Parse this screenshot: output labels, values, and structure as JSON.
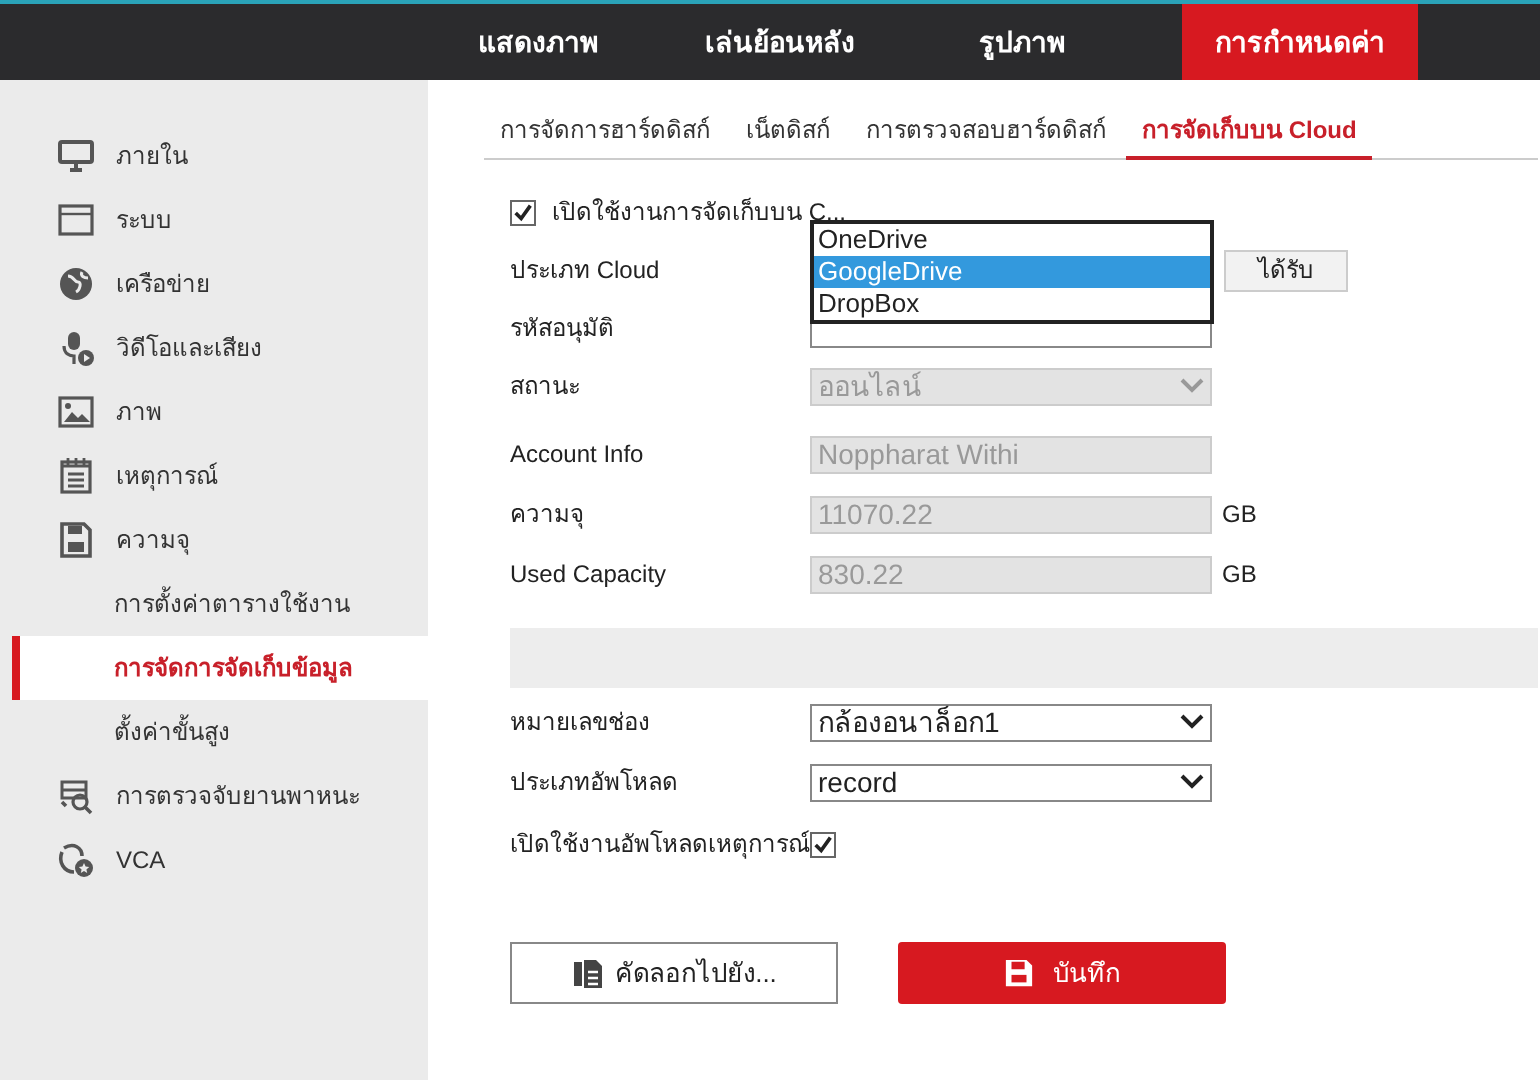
{
  "top_nav": [
    {
      "label": "แสดงภาพ",
      "selected": false
    },
    {
      "label": "เล่นย้อนหลัง",
      "selected": false
    },
    {
      "label": "รูปภาพ",
      "selected": false
    },
    {
      "label": "การกำหนดค่า",
      "selected": true
    }
  ],
  "sidebar": {
    "items": [
      {
        "label": "ภายใน",
        "kind": "monitor",
        "selected": false
      },
      {
        "label": "ระบบ",
        "kind": "window",
        "selected": false
      },
      {
        "label": "เครือข่าย",
        "kind": "globe",
        "selected": false
      },
      {
        "label": "วิดีโอและเสียง",
        "kind": "mic",
        "selected": false
      },
      {
        "label": "ภาพ",
        "kind": "image",
        "selected": false
      },
      {
        "label": "เหตุการณ์",
        "kind": "calendar",
        "selected": false
      },
      {
        "label": "ความจุ",
        "kind": "disk",
        "selected": false,
        "children": [
          {
            "label": "การตั้งค่าตารางใช้งาน",
            "selected": false
          },
          {
            "label": "การจัดการจัดเก็บข้อมูล",
            "selected": true
          },
          {
            "label": "ตั้งค่าขั้นสูง",
            "selected": false
          }
        ]
      },
      {
        "label": "การตรวจจับยานพาหนะ",
        "kind": "vehicle",
        "selected": false
      },
      {
        "label": "VCA",
        "kind": "vca",
        "selected": false
      }
    ]
  },
  "tabs": [
    {
      "label": "การจัดการฮาร์ดดิสก์",
      "selected": false
    },
    {
      "label": "เน็ตดิสก์",
      "selected": false
    },
    {
      "label": "การตรวจสอบฮาร์ดดิสก์",
      "selected": false
    },
    {
      "label": "การจัดเก็บบน Cloud",
      "selected": true
    }
  ],
  "form": {
    "enable_cloud": {
      "label": "เปิดใช้งานการจัดเก็บบน C...",
      "checked": true
    },
    "cloud_type": {
      "label": "ประเภท Cloud",
      "options": [
        {
          "label": "OneDrive",
          "selected": false
        },
        {
          "label": "GoogleDrive",
          "selected": true
        },
        {
          "label": "DropBox",
          "selected": false
        }
      ],
      "button": "ได้รับ"
    },
    "auth_code": {
      "label": "รหัสอนุมัติ"
    },
    "status": {
      "label": "สถานะ",
      "value": "ออนไลน์"
    },
    "account_info": {
      "label": "Account Info",
      "value": "Noppharat Withi"
    },
    "capacity": {
      "label": "ความจุ",
      "value": "11070.22",
      "unit": "GB"
    },
    "used_capacity": {
      "label": "Used Capacity",
      "value": "830.22",
      "unit": "GB"
    },
    "channel": {
      "label": "หมายเลขช่อง",
      "value": "กล้องอนาล็อก1"
    },
    "upload_type": {
      "label": "ประเภทอัพโหลด",
      "value": "record"
    },
    "event_upload": {
      "label": "เปิดใช้งานอัพโหลดเหตุการณ์",
      "checked": true
    }
  },
  "buttons": {
    "copy": "คัดลอกไปยัง...",
    "save": "บันทึก"
  }
}
